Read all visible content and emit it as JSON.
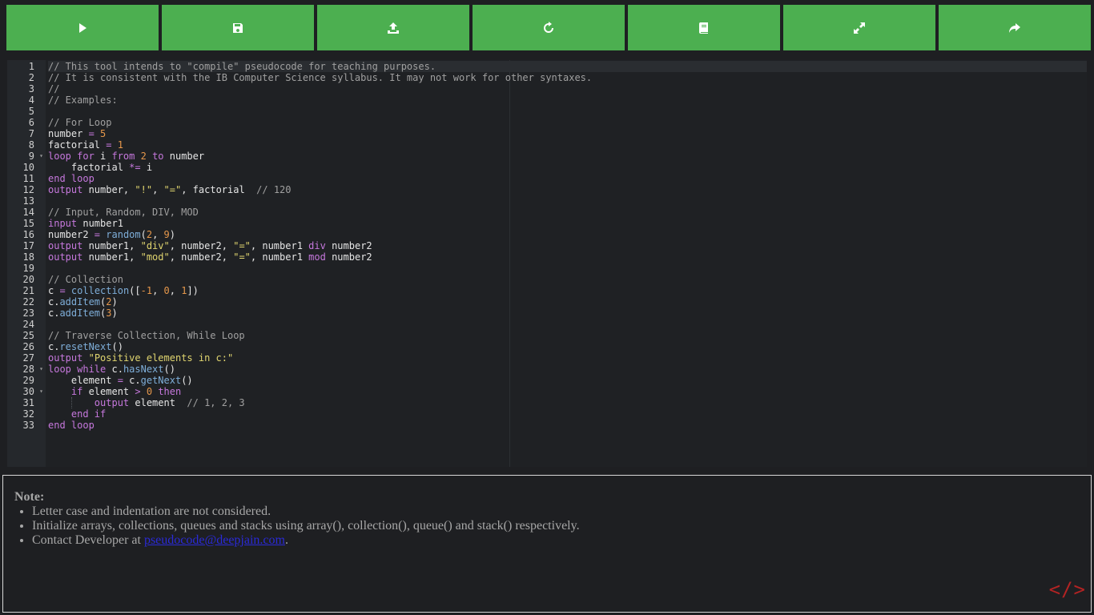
{
  "toolbar": {
    "buttons": [
      {
        "name": "run",
        "icon": "play-icon"
      },
      {
        "name": "save",
        "icon": "save-icon"
      },
      {
        "name": "upload",
        "icon": "upload-icon"
      },
      {
        "name": "reset",
        "icon": "refresh-icon"
      },
      {
        "name": "docs",
        "icon": "book-icon"
      },
      {
        "name": "fullscreen",
        "icon": "expand-icon"
      },
      {
        "name": "share",
        "icon": "share-icon"
      }
    ],
    "color": "#4caf50"
  },
  "editor": {
    "line_numbers": [
      "1",
      "2",
      "3",
      "4",
      "5",
      "6",
      "7",
      "8",
      "9",
      "10",
      "11",
      "12",
      "13",
      "14",
      "15",
      "16",
      "17",
      "18",
      "19",
      "20",
      "21",
      "22",
      "23",
      "24",
      "25",
      "26",
      "27",
      "28",
      "29",
      "30",
      "31",
      "32",
      "33"
    ],
    "fold_lines": [
      9,
      28,
      30
    ],
    "active_line": 1,
    "lines": [
      [
        [
          "cm",
          "// This tool intends to \"compile\" pseudocode for teaching purposes."
        ]
      ],
      [
        [
          "cm",
          "// It is consistent with the IB Computer Science syllabus. It may not work for other syntaxes."
        ]
      ],
      [
        [
          "cm",
          "//"
        ]
      ],
      [
        [
          "cm",
          "// Examples:"
        ]
      ],
      [],
      [
        [
          "cm",
          "// For Loop"
        ]
      ],
      [
        [
          "",
          "number "
        ],
        [
          "op",
          "="
        ],
        [
          "",
          ""
        ],
        [
          "num",
          " 5"
        ]
      ],
      [
        [
          "",
          "factorial "
        ],
        [
          "op",
          "="
        ],
        [
          "num",
          " 1"
        ]
      ],
      [
        [
          "kw",
          "loop for"
        ],
        [
          "",
          " i "
        ],
        [
          "kw",
          "from"
        ],
        [
          "num",
          " 2"
        ],
        [
          "",
          " "
        ],
        [
          "kw",
          "to"
        ],
        [
          "",
          " number"
        ]
      ],
      [
        [
          "",
          "    factorial "
        ],
        [
          "op",
          "*="
        ],
        [
          "",
          " i"
        ]
      ],
      [
        [
          "kw",
          "end loop"
        ]
      ],
      [
        [
          "kw",
          "output"
        ],
        [
          "",
          " number, "
        ],
        [
          "str",
          "\"!\""
        ],
        [
          "",
          ", "
        ],
        [
          "str",
          "\"=\""
        ],
        [
          "",
          ", factorial  "
        ],
        [
          "cm",
          "// 120"
        ]
      ],
      [],
      [
        [
          "cm",
          "// Input, Random, DIV, MOD"
        ]
      ],
      [
        [
          "kw",
          "input"
        ],
        [
          "",
          " number1"
        ]
      ],
      [
        [
          "",
          "number2 "
        ],
        [
          "op",
          "="
        ],
        [
          "",
          " "
        ],
        [
          "fn",
          "random"
        ],
        [
          "",
          "("
        ],
        [
          "num",
          "2"
        ],
        [
          "",
          ", "
        ],
        [
          "num",
          "9"
        ],
        [
          "",
          ")"
        ]
      ],
      [
        [
          "kw",
          "output"
        ],
        [
          "",
          " number1, "
        ],
        [
          "str",
          "\"div\""
        ],
        [
          "",
          ", number2, "
        ],
        [
          "str",
          "\"=\""
        ],
        [
          "",
          ", number1 "
        ],
        [
          "kw",
          "div"
        ],
        [
          "",
          " number2"
        ]
      ],
      [
        [
          "kw",
          "output"
        ],
        [
          "",
          " number1, "
        ],
        [
          "str",
          "\"mod\""
        ],
        [
          "",
          ", number2, "
        ],
        [
          "str",
          "\"=\""
        ],
        [
          "",
          ", number1 "
        ],
        [
          "kw",
          "mod"
        ],
        [
          "",
          " number2"
        ]
      ],
      [],
      [
        [
          "cm",
          "// Collection"
        ]
      ],
      [
        [
          "",
          "c "
        ],
        [
          "op",
          "="
        ],
        [
          "",
          " "
        ],
        [
          "fn",
          "collection"
        ],
        [
          "",
          "(["
        ],
        [
          "num",
          "-1"
        ],
        [
          "",
          ", "
        ],
        [
          "num",
          "0"
        ],
        [
          "",
          ", "
        ],
        [
          "num",
          "1"
        ],
        [
          "",
          "])"
        ]
      ],
      [
        [
          "",
          "c."
        ],
        [
          "fn",
          "addItem"
        ],
        [
          "",
          "("
        ],
        [
          "num",
          "2"
        ],
        [
          "",
          ")"
        ]
      ],
      [
        [
          "",
          "c."
        ],
        [
          "fn",
          "addItem"
        ],
        [
          "",
          "("
        ],
        [
          "num",
          "3"
        ],
        [
          "",
          ")"
        ]
      ],
      [],
      [
        [
          "cm",
          "// Traverse Collection, While Loop"
        ]
      ],
      [
        [
          "",
          "c."
        ],
        [
          "fn",
          "resetNext"
        ],
        [
          "",
          "()"
        ]
      ],
      [
        [
          "kw",
          "output"
        ],
        [
          "",
          " "
        ],
        [
          "str",
          "\"Positive elements in c:\""
        ]
      ],
      [
        [
          "kw",
          "loop while"
        ],
        [
          "",
          " c."
        ],
        [
          "fn",
          "hasNext"
        ],
        [
          "",
          "()"
        ]
      ],
      [
        [
          "",
          "    element "
        ],
        [
          "op",
          "="
        ],
        [
          "",
          " c."
        ],
        [
          "fn",
          "getNext"
        ],
        [
          "",
          "()"
        ]
      ],
      [
        [
          "kw",
          "    if"
        ],
        [
          "",
          " element "
        ],
        [
          "op",
          ">"
        ],
        [
          "num",
          " 0"
        ],
        [
          "",
          " "
        ],
        [
          "kw",
          "then"
        ]
      ],
      [
        [
          "kw",
          "        output"
        ],
        [
          "",
          " element  "
        ],
        [
          "cm",
          "// 1, 2, 3"
        ]
      ],
      [
        [
          "kw",
          "    end if"
        ]
      ],
      [
        [
          "kw",
          "end loop"
        ]
      ]
    ]
  },
  "notes": {
    "title": "Note:",
    "items": [
      "Letter case and indentation are not considered.",
      "Initialize arrays, collections, queues and stacks using array(), collection(), queue() and stack() respectively."
    ],
    "contact_prefix": "Contact Developer at ",
    "contact_email": "pseudocode@deepjain.com",
    "contact_suffix": "."
  },
  "logo": {
    "text": "</>",
    "color": "#b32323"
  }
}
